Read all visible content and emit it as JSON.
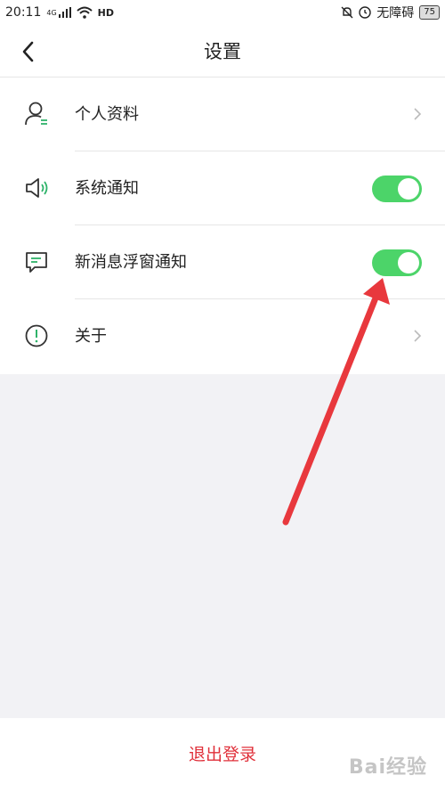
{
  "status_bar": {
    "time": "20:11",
    "network": "4G",
    "hd": "HD",
    "accessibility": "无障碍",
    "battery": "75"
  },
  "header": {
    "title": "设置",
    "back_icon": "chevron-left-icon"
  },
  "settings": {
    "items": [
      {
        "label": "个人资料",
        "icon": "person-icon",
        "control": "chevron"
      },
      {
        "label": "系统通知",
        "icon": "speaker-icon",
        "control": "toggle",
        "on": true
      },
      {
        "label": "新消息浮窗通知",
        "icon": "message-icon",
        "control": "toggle",
        "on": true
      },
      {
        "label": "关于",
        "icon": "info-icon",
        "control": "chevron"
      }
    ]
  },
  "footer": {
    "logout_label": "退出登录"
  },
  "watermark": "Bai经验",
  "colors": {
    "toggle_on": "#4cd469",
    "logout": "#e0303a",
    "arrow": "#e8383d",
    "accent_icon": "#2fb36a"
  }
}
